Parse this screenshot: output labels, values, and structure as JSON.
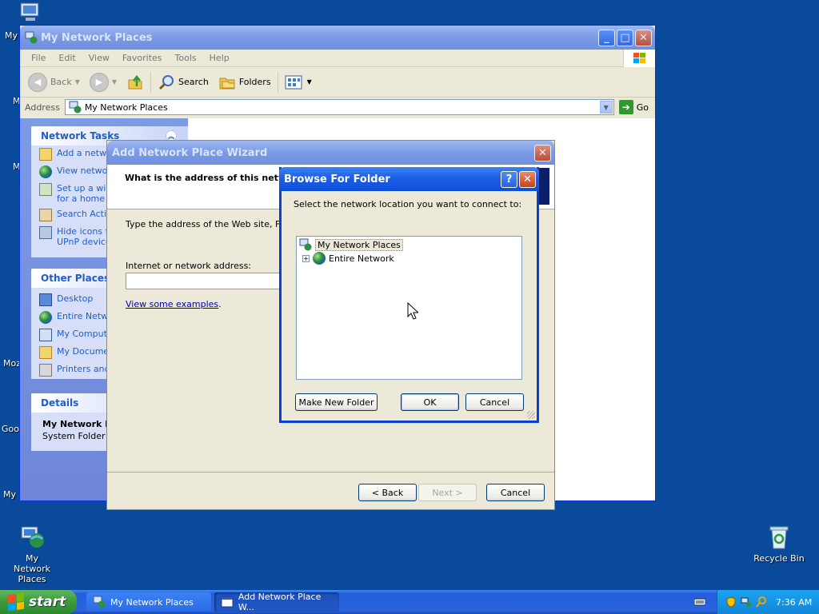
{
  "desktop": {
    "icons": [
      {
        "label": "My Network Places"
      },
      {
        "label": "Recycle Bin"
      }
    ],
    "clipped_labels": [
      "My",
      "M",
      "M",
      "Moz",
      "Goo",
      "My I"
    ]
  },
  "main_window": {
    "title": "My Network Places",
    "menu": [
      "File",
      "Edit",
      "View",
      "Favorites",
      "Tools",
      "Help"
    ],
    "toolbar": {
      "back": "Back",
      "search": "Search",
      "folders": "Folders"
    },
    "address_label": "Address",
    "address_value": "My Network Places",
    "go_label": "Go",
    "network_tasks": {
      "header": "Network Tasks",
      "items": [
        "Add a netwo",
        "View networ",
        "Set up a wir",
        "for a home o",
        "Search Activ",
        "Hide icons fo",
        "UPnP device"
      ]
    },
    "other_places": {
      "header": "Other Places",
      "items": [
        "Desktop",
        "Entire Netwo",
        "My Compute",
        "My Documen",
        "Printers and"
      ]
    },
    "details": {
      "header": "Details",
      "name": "My Network Pl",
      "type": "System Folder"
    }
  },
  "wizard": {
    "title": "Add Network Place Wizard",
    "heading": "What is the address of this networ",
    "instruction": "Type the address of the Web site, FTP s",
    "field_label": "Internet or network address:",
    "field_value": "",
    "examples_link": "View some examples",
    "examples_period": ".",
    "back_button": "< Back",
    "next_button": "Next >",
    "cancel_button": "Cancel"
  },
  "browse_dialog": {
    "title": "Browse For Folder",
    "help_glyph": "?",
    "prompt": "Select the network location you want to connect to:",
    "tree": [
      {
        "label": "My Network Places",
        "selected": true
      },
      {
        "label": "Entire Network",
        "expander": "+"
      }
    ],
    "make_folder_button": "Make New Folder",
    "ok_button": "OK",
    "cancel_button": "Cancel"
  },
  "taskbar": {
    "start_label": "start",
    "tasks": [
      {
        "label": "My Network Places"
      },
      {
        "label": "Add Network Place W..."
      }
    ],
    "clock": "7:36 AM"
  }
}
